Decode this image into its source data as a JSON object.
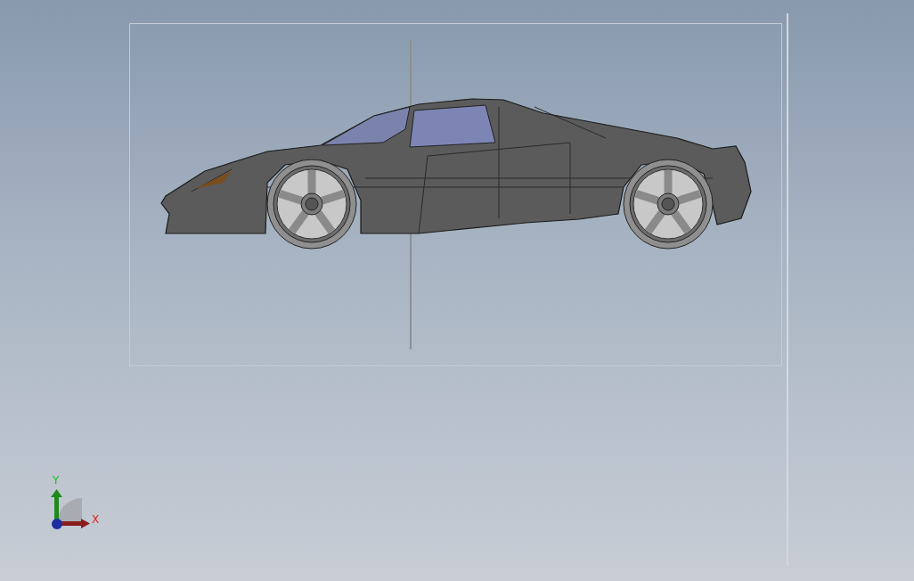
{
  "viewport": {
    "axis_triad": {
      "y_label": "Y",
      "x_label": "X"
    }
  }
}
